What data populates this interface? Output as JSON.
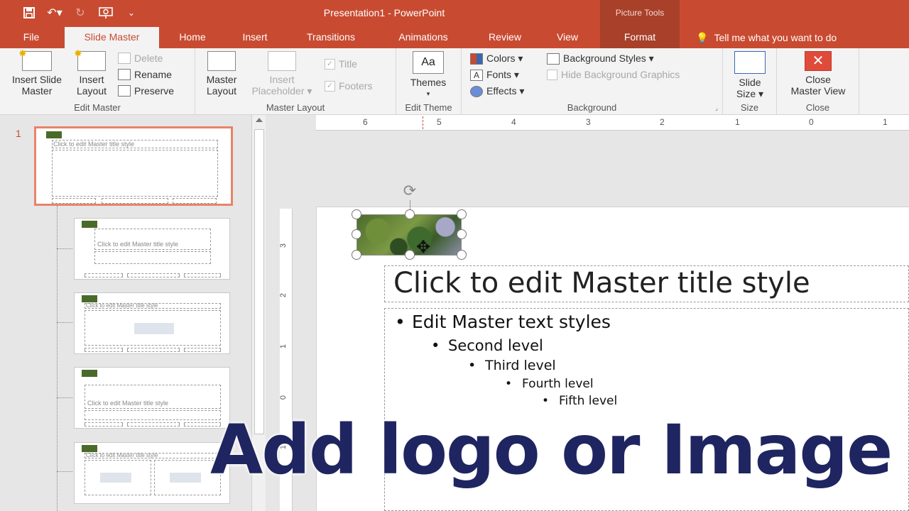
{
  "window": {
    "title": "Presentation1 - PowerPoint",
    "context_title": "Picture Tools"
  },
  "tabs": [
    {
      "label": "File"
    },
    {
      "label": "Slide Master"
    },
    {
      "label": "Home"
    },
    {
      "label": "Insert"
    },
    {
      "label": "Transitions"
    },
    {
      "label": "Animations"
    },
    {
      "label": "Review"
    },
    {
      "label": "View"
    },
    {
      "label": "Format"
    }
  ],
  "tellme": "Tell me what you want to do",
  "ribbon": {
    "edit_master": {
      "label": "Edit Master",
      "insert_slide_master_1": "Insert Slide",
      "insert_slide_master_2": "Master",
      "insert_layout_1": "Insert",
      "insert_layout_2": "Layout",
      "delete": "Delete",
      "rename": "Rename",
      "preserve": "Preserve"
    },
    "master_layout": {
      "label": "Master Layout",
      "master_layout_1": "Master",
      "master_layout_2": "Layout",
      "insert_placeholder_1": "Insert",
      "insert_placeholder_2": "Placeholder ▾",
      "title": "Title",
      "footers": "Footers"
    },
    "edit_theme": {
      "label": "Edit Theme",
      "themes": "Themes",
      "themes_icon_text": "Aa"
    },
    "background": {
      "label": "Background",
      "colors": "Colors ▾",
      "fonts": "Fonts ▾",
      "effects": "Effects ▾",
      "background_styles": "Background Styles ▾",
      "hide_background_graphics": "Hide Background Graphics"
    },
    "size": {
      "label": "Size",
      "slide_size_1": "Slide",
      "slide_size_2": "Size ▾"
    },
    "close": {
      "label": "Close",
      "close_master_view_1": "Close",
      "close_master_view_2": "Master View"
    }
  },
  "thumbnails": {
    "slide_number": "1"
  },
  "ruler": {
    "h_numbers": [
      "6",
      "5",
      "4",
      "3",
      "2",
      "1",
      "0",
      "1"
    ],
    "v_numbers": [
      "3",
      "2",
      "1",
      "0",
      "1"
    ]
  },
  "slide": {
    "title": "Click to edit Master title style",
    "levels": [
      "Edit Master text styles",
      "Second level",
      "Third level",
      "Fourth level",
      "Fifth level"
    ]
  },
  "overlay_text": "Add logo or Image",
  "colors": {
    "accent": "#c84b31",
    "overlay": "#1f2560"
  }
}
